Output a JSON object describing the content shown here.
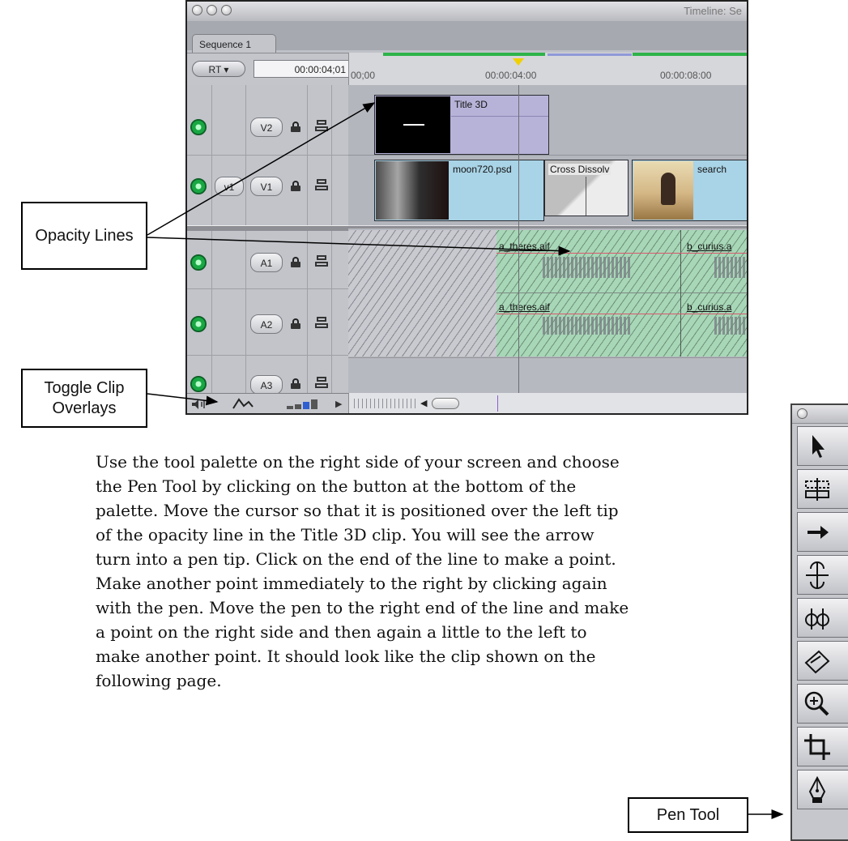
{
  "timeline_window": {
    "title": "Timeline: Se",
    "sequence_tab": "Sequence 1",
    "rt_button": "RT ▾",
    "current_timecode": "00:00:04;01",
    "ruler_ticks": [
      "00;00",
      "00:00:04:00",
      "00:00:08:00"
    ],
    "tracks": {
      "v2": {
        "label": "V2"
      },
      "v1": {
        "label": "V1",
        "source_label": "v1"
      },
      "a1": {
        "label": "A1"
      },
      "a2": {
        "label": "A2"
      },
      "a3": {
        "label": "A3"
      }
    },
    "clips": {
      "title3d": "Title 3D",
      "moon": "moon720.psd",
      "cross_dissolve": "Cross Dissolv",
      "search": "search",
      "a1_left": "a_theres.aif",
      "a1_right": "b_curius.a",
      "a2_left": "a_theres.aif",
      "a2_right": "b_curius.a"
    }
  },
  "callouts": {
    "opacity_lines": "Opacity Lines",
    "toggle_clip_overlays": "Toggle Clip Overlays",
    "pen_tool": "Pen Tool"
  },
  "body_text": "Use the tool palette on the right side of your screen and choose the Pen Tool by clicking on the button at the bottom of the palette. Move the cursor so that it is positioned over the left tip of the opacity line in the Title 3D clip. You will see the arrow turn into a pen tip. Click on the end of the line to make a point. Make another point immediately to the right by clicking again with the pen. Move the pen to the right end of the line and make a point on the right side and then again a little to the left to make another point. It should look like the clip shown on the following page.",
  "tool_palette": {
    "tools": [
      "selection-tool",
      "edit-selection-tool",
      "track-select-tool",
      "roll-tool",
      "slip-tool",
      "razor-tool",
      "zoom-tool",
      "crop-tool",
      "pen-tool"
    ]
  },
  "colors": {
    "video_clip": "#a9d3e6",
    "title_clip": "#b7b3d8",
    "audio_clip": "#a7d7b7",
    "opacity_line": "#d9596e",
    "timeline_green": "#2db34a"
  }
}
